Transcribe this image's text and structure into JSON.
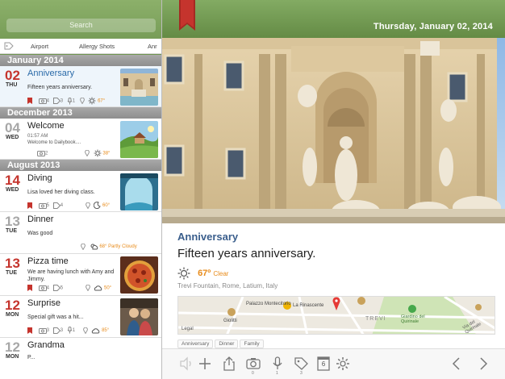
{
  "search": {
    "placeholder": "Search"
  },
  "tags": [
    "Airport",
    "Allergy Shots",
    "Anr"
  ],
  "sections": [
    "January 2014",
    "December 2013",
    "August 2013"
  ],
  "entries": [
    {
      "day": "02",
      "weekday": "THU",
      "title": "Anniversary",
      "text": "Fifteen years anniversary.",
      "photos": "4",
      "tags": "3",
      "audio": "1",
      "temp": "67°"
    },
    {
      "day": "04",
      "weekday": "WED",
      "title": "Welcome",
      "time": "01:57 AM",
      "text": "Welcome to Dailybook....",
      "photos": "2",
      "temp": "38°"
    },
    {
      "day": "14",
      "weekday": "WED",
      "title": "Diving",
      "text": "Lisa loved her diving class.",
      "photos": "5",
      "tags": "4",
      "temp": "60°"
    },
    {
      "day": "13",
      "weekday": "TUE",
      "title": "Dinner",
      "text": "Was good",
      "weather": "68° Partly Cloudy"
    },
    {
      "day": "13",
      "weekday": "TUE",
      "title": "Pizza time",
      "text": "We are having lunch with Amy and Jimmy.",
      "photos": "4",
      "tags": "5",
      "temp": "50°"
    },
    {
      "day": "12",
      "weekday": "MON",
      "title": "Surprise",
      "text": "Special gift was a hit...",
      "photos": "3",
      "tags": "3",
      "audio": "1",
      "temp": "85°"
    },
    {
      "day": "12",
      "weekday": "MON",
      "title": "Grandma",
      "text": "P..."
    }
  ],
  "detail": {
    "date": "Thursday, January 02, 2014",
    "title": "Anniversary",
    "text": "Fifteen years anniversary.",
    "temp": "67º",
    "condition": "Clear",
    "location": "Trevi Fountain, Rome, Latium, Italy",
    "map_labels": [
      "Palazzo Montecitorio",
      "La Rinascente",
      "Giolitti",
      "TREVI",
      "Giardino del Quirinale",
      "Via del Quirinale",
      "Legal"
    ],
    "tags": [
      "Anniversary",
      "Dinner",
      "Family"
    ]
  },
  "toolbar": {
    "photo_count": "0",
    "audio_count": "1",
    "tag_count": "3",
    "page_number": "6"
  },
  "colors": {
    "accent_red": "#c5342d",
    "header_green": "#739a54",
    "title_blue": "#3a5e8c",
    "weather_orange": "#e88b1a"
  }
}
